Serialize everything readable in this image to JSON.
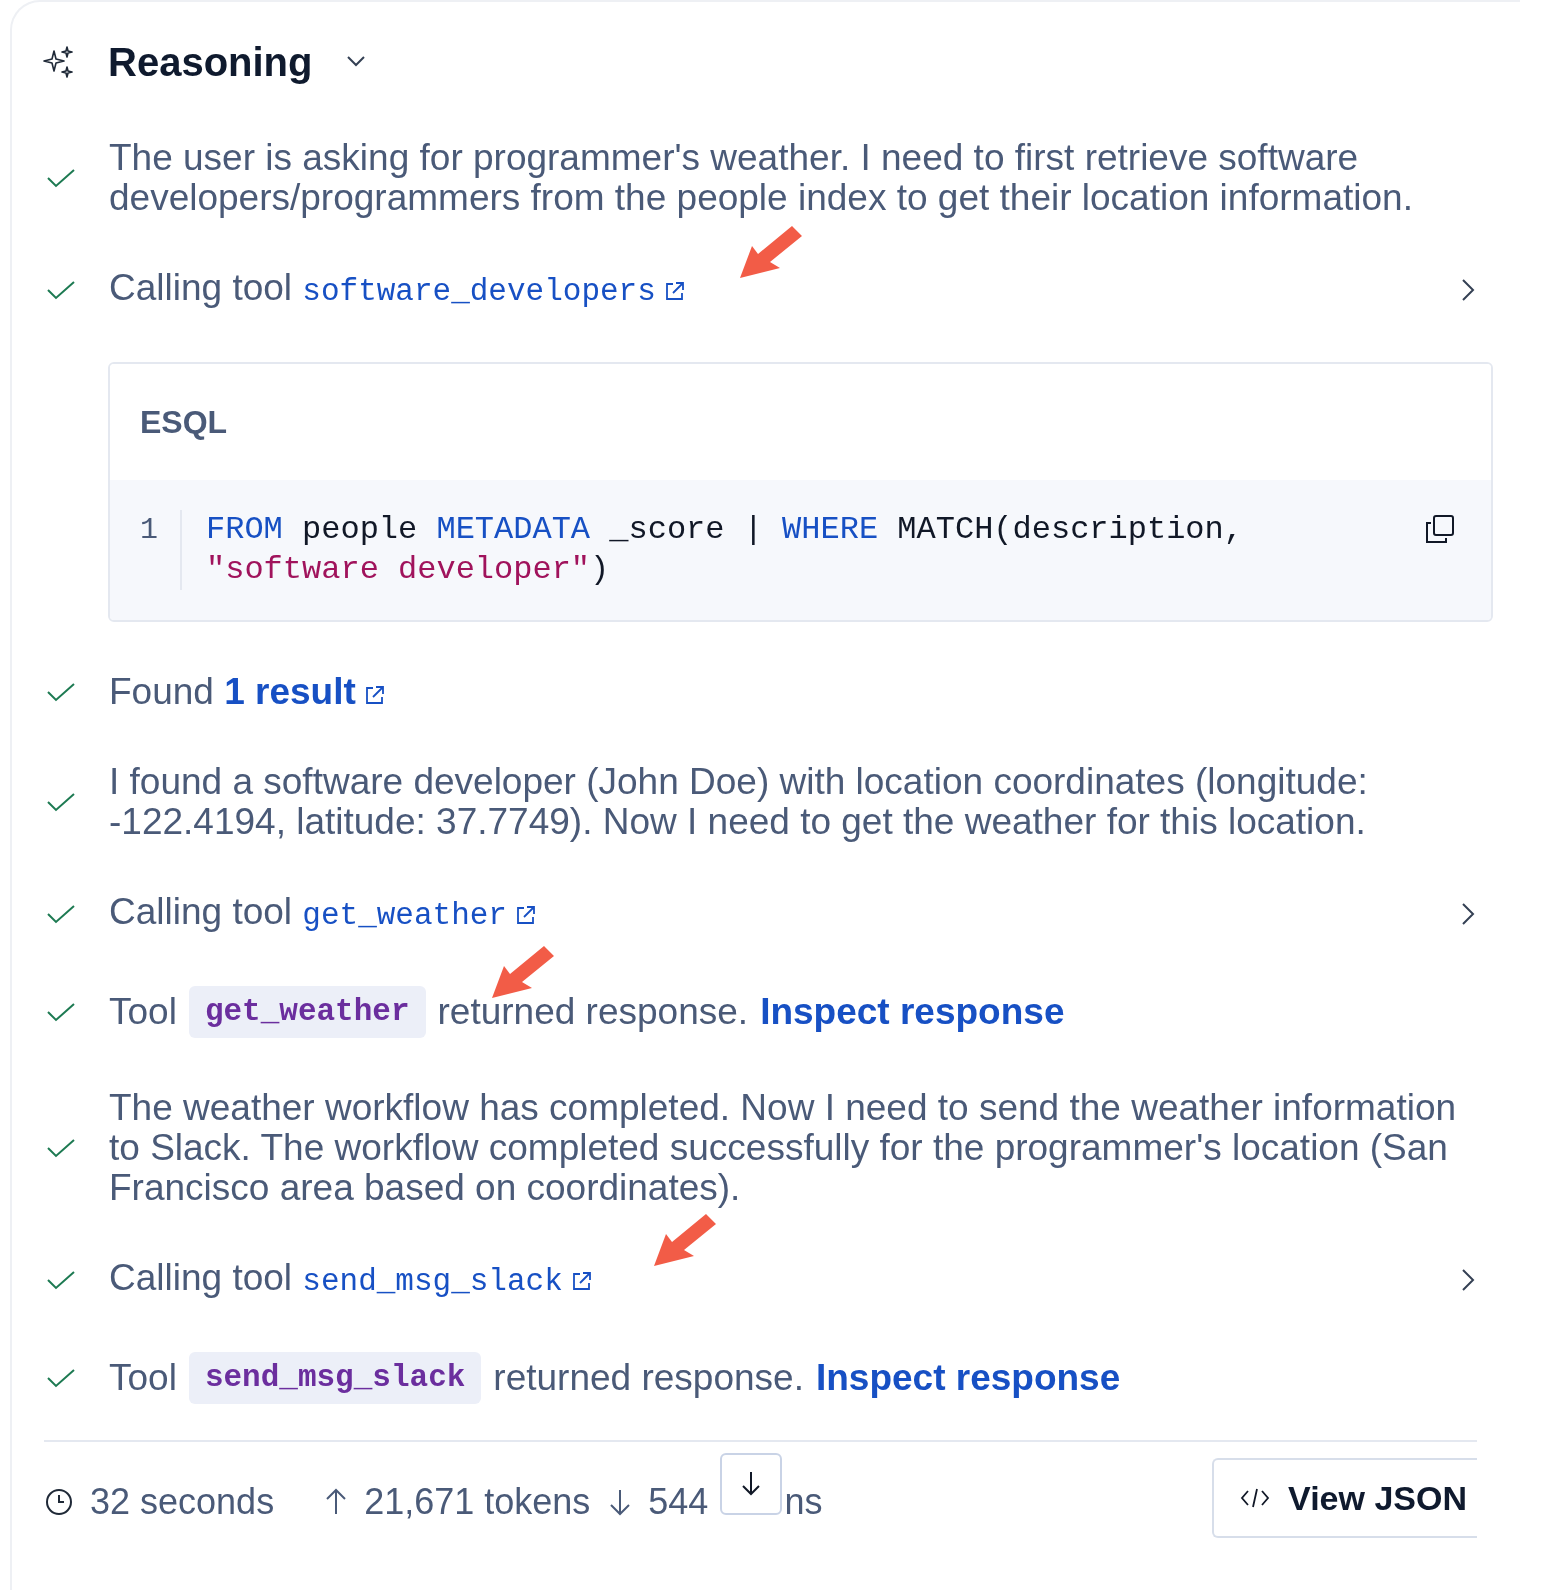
{
  "header": {
    "title": "Reasoning",
    "expanded": true
  },
  "steps": [
    {
      "kind": "text",
      "done": true,
      "text": "The user is asking for programmer's weather. I need to first retrieve software developers/programmers from the people index to get their location information."
    },
    {
      "kind": "call",
      "done": true,
      "prefix": "Calling tool",
      "tool": "software_developers",
      "expanded": false
    },
    {
      "kind": "code",
      "label": "ESQL",
      "line_number": "1",
      "tokens": [
        {
          "kind": "keyword",
          "text": "FROM"
        },
        {
          "kind": "plain",
          "text": " people "
        },
        {
          "kind": "keyword",
          "text": "METADATA"
        },
        {
          "kind": "plain",
          "text": " _score | "
        },
        {
          "kind": "keyword",
          "text": "WHERE"
        },
        {
          "kind": "plain",
          "text": " MATCH(description, "
        },
        {
          "kind": "string",
          "text": "\"software developer\""
        },
        {
          "kind": "plain",
          "text": ")"
        }
      ]
    },
    {
      "kind": "result",
      "done": true,
      "prefix": "Found",
      "link": "1 result"
    },
    {
      "kind": "text",
      "done": true,
      "text": "I found a software developer (John Doe) with location coordinates (longitude: -122.4194, latitude: 37.7749). Now I need to get the weather for this location."
    },
    {
      "kind": "call",
      "done": true,
      "prefix": "Calling tool",
      "tool": "get_weather",
      "expanded": false
    },
    {
      "kind": "response",
      "done": true,
      "prefix": "Tool",
      "tool": "get_weather",
      "suffix": "returned response.",
      "link": "Inspect response"
    },
    {
      "kind": "text",
      "done": true,
      "text": "The weather workflow has completed. Now I need to send the weather information to Slack. The workflow completed successfully for the programmer's location (San Francisco area based on coordinates)."
    },
    {
      "kind": "call",
      "done": true,
      "prefix": "Calling tool",
      "tool": "send_msg_slack",
      "expanded": false
    },
    {
      "kind": "response",
      "done": true,
      "prefix": "Tool",
      "tool": "send_msg_slack",
      "suffix": "returned response.",
      "link": "Inspect response"
    }
  ],
  "footer": {
    "duration": "32 seconds",
    "input_tokens": "21,671 tokens",
    "output_tokens_start": "544",
    "output_tokens_end": "ns",
    "view_button": "View JSON"
  }
}
